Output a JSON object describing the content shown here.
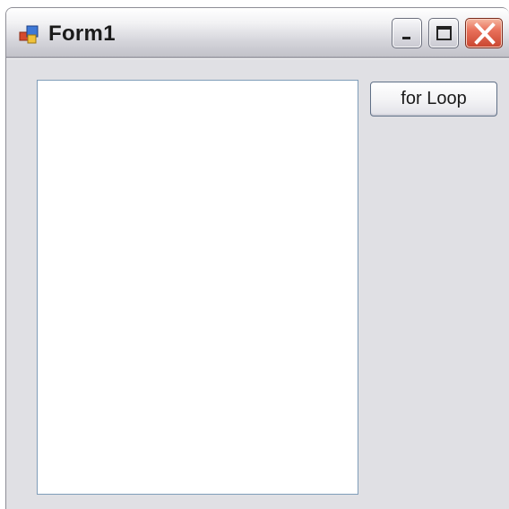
{
  "window": {
    "title": "Form1",
    "icon": "winforms-app-icon",
    "caption_buttons": [
      "minimize-icon",
      "maximize-icon",
      "close-icon"
    ]
  },
  "form": {
    "listbox_items": [],
    "button_label": "for Loop"
  },
  "colors": {
    "client_background": "#e0e0e4",
    "listbox_border": "#7f9db9",
    "close_button": "#d9553d"
  }
}
